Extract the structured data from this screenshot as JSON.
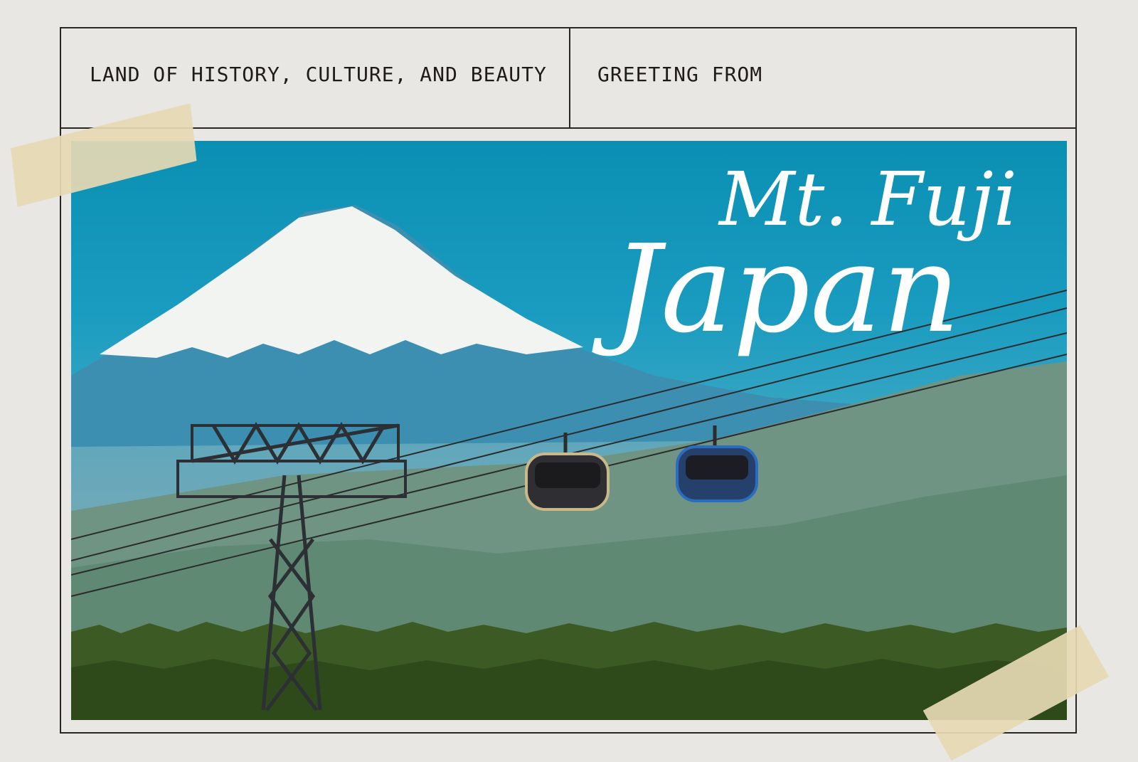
{
  "header": {
    "tagline": "LAND OF HISTORY, CULTURE, AND BEAUTY",
    "greeting": "GREETING FROM"
  },
  "title": {
    "line1": "Mt. Fuji",
    "line2": "Japan"
  },
  "colors": {
    "background": "#e8e7e4",
    "frame": "#2a2626",
    "sky": "#0a8fb3",
    "tape": "#e6d9b4",
    "title": "#ffffff"
  }
}
